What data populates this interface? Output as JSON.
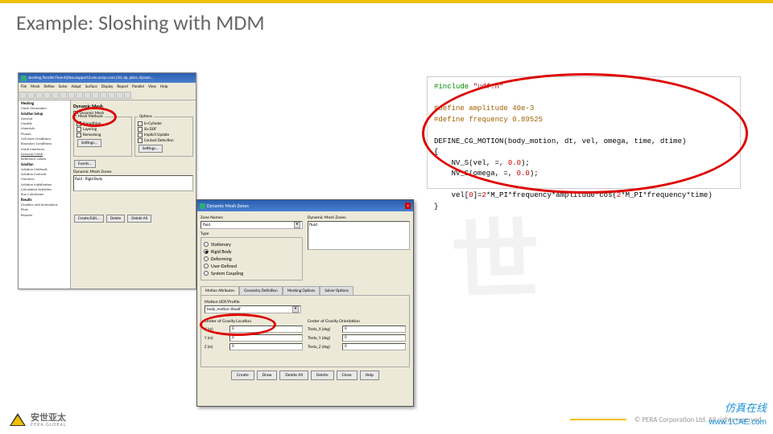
{
  "slide": {
    "title": "Example: Sloshing with MDM"
  },
  "win1": {
    "title": "sloshing Parallel Fluent@bousupport2.win.ansys.com [3d, dp, pbns, dynam...",
    "menu": [
      "File",
      "Mesh",
      "Define",
      "Solve",
      "Adapt",
      "Surface",
      "Display",
      "Report",
      "Parallel",
      "View",
      "Help"
    ],
    "tree": {
      "meshing": "Meshing",
      "meshgen": "Mesh Generation",
      "solsetup": "Solution Setup",
      "items": [
        "General",
        "Models",
        "Materials",
        "Phases",
        "Cell Zone Conditions",
        "Boundary Conditions",
        "Mesh Interfaces"
      ],
      "dynmesh": "Dynamic Mesh",
      "refvals": "Reference Values",
      "solution": "Solution",
      "solitems": [
        "Solution Methods",
        "Solution Controls",
        "Monitors",
        "Solution Initialization",
        "Calculation Activities",
        "Run Calculation"
      ],
      "results": "Results",
      "resitems": [
        "Graphics and Animations",
        "Plots",
        "Reports"
      ]
    },
    "panel": {
      "header": "Dynamic Mesh",
      "dynmesh_chk": "Dynamic Mesh",
      "meshmethods": "Mesh Methods",
      "options": "Options",
      "smoothing": "Smoothing",
      "layering": "Layering",
      "remeshing": "Remeshing",
      "incyl": "In-Cylinder",
      "sixdof": "Six DOF",
      "implicit": "Implicit Update",
      "contact": "Contact Detection",
      "settings": "Settings...",
      "events": "Events...",
      "zones_lbl": "Dynamic Mesh Zones",
      "zone_item": "fluid - Rigid Body",
      "create": "Create/Edit...",
      "delete": "Delete",
      "deleteall": "Delete All"
    }
  },
  "win2": {
    "title": "Dynamic Mesh Zones",
    "zone_names": "Zone Names",
    "fluid": "fluid",
    "dmz_lbl": "Dynamic Mesh Zones",
    "dmz_item": "fluid",
    "type": "Type",
    "types": {
      "stationary": "Stationary",
      "rigid": "Rigid Body",
      "deforming": "Deforming",
      "userdef": "User-Defined",
      "syscoup": "System Coupling"
    },
    "tabs": {
      "motion": "Motion Attributes",
      "geom": "Geometry Definition",
      "mesh": "Meshing Options",
      "solver": "Solver Options"
    },
    "udf_lbl": "Motion UDF/Profile",
    "udf_val": "body_motion::libudf",
    "cg_loc": "Center of Gravity Location",
    "cg_ori": "Center of Gravity Orientation",
    "x": "X (m)",
    "y": "Y (m)",
    "z": "Z (m)",
    "tx": "Theta_X (deg)",
    "ty": "Theta_Y (deg)",
    "tz": "Theta_Z (deg)",
    "v0": "0",
    "btns": {
      "create": "Create",
      "draw": "Draw",
      "delall": "Delete All",
      "delete": "Delete",
      "close": "Close",
      "help": "Help"
    }
  },
  "code": {
    "l1a": "#include",
    "l1b": " \"udf.h\"",
    "l2": "#define amplitude 40e-3",
    "l3": "#define frequency 0.89525",
    "l4": "DEFINE_CG_MOTION(body_motion, dt, vel, omega, time, dtime)",
    "l5": "{",
    "l6a": "    NV_S(vel, =, ",
    "l6b": "0.0",
    "l6c": ");",
    "l7a": "    NV_S(omega, =, ",
    "l7b": "0.0",
    "l7c": ");",
    "l8a": "    vel[",
    "l8b": "0",
    "l8c": "]=",
    "l8d": "2",
    "l8e": "*M_PI*frequency*amplitude*cos(",
    "l8f": "2",
    "l8g": "*M_PI*frequency*time)",
    "l9": "}"
  },
  "footer": {
    "cn": "安世亚太",
    "en": "PERA GLOBAL",
    "copy": "© PERA Corporation Ltd. All rights reserved.",
    "cae_cn": "仿真在线",
    "cae_url": "www.1CAE.com"
  }
}
